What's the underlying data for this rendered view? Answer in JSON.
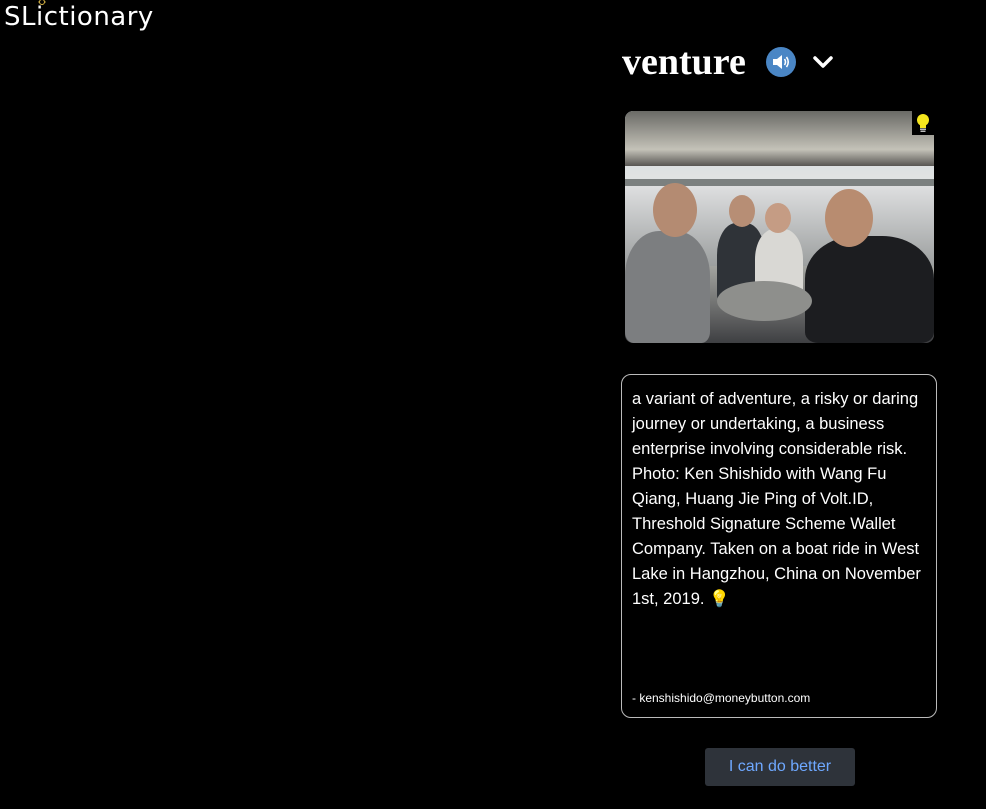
{
  "app": {
    "logo_text": "SLictionary"
  },
  "entry": {
    "word": "venture",
    "definition": "a variant of adventure, a risky or daring journey or undertaking, a business enterprise involving considerable risk. Photo: Ken Shishido with Wang Fu Qiang, Huang Jie Ping of Volt.ID, Threshold Signature Scheme Wallet Company. Taken on a boat ride in West Lake in Hangzhou, China on November 1st, 2019. 💡",
    "author": "- kenshishido@moneybutton.com"
  },
  "actions": {
    "improve_label": "I can do better"
  },
  "icons": {
    "speaker": "speaker-icon",
    "chevron": "chevron-down-icon",
    "bulb": "lightbulb-icon"
  },
  "colors": {
    "background": "#000000",
    "speaker_bg": "#4a86c5",
    "bulb": "#f5e61d",
    "button_bg": "#2e333a",
    "button_text": "#6ea8ff"
  }
}
